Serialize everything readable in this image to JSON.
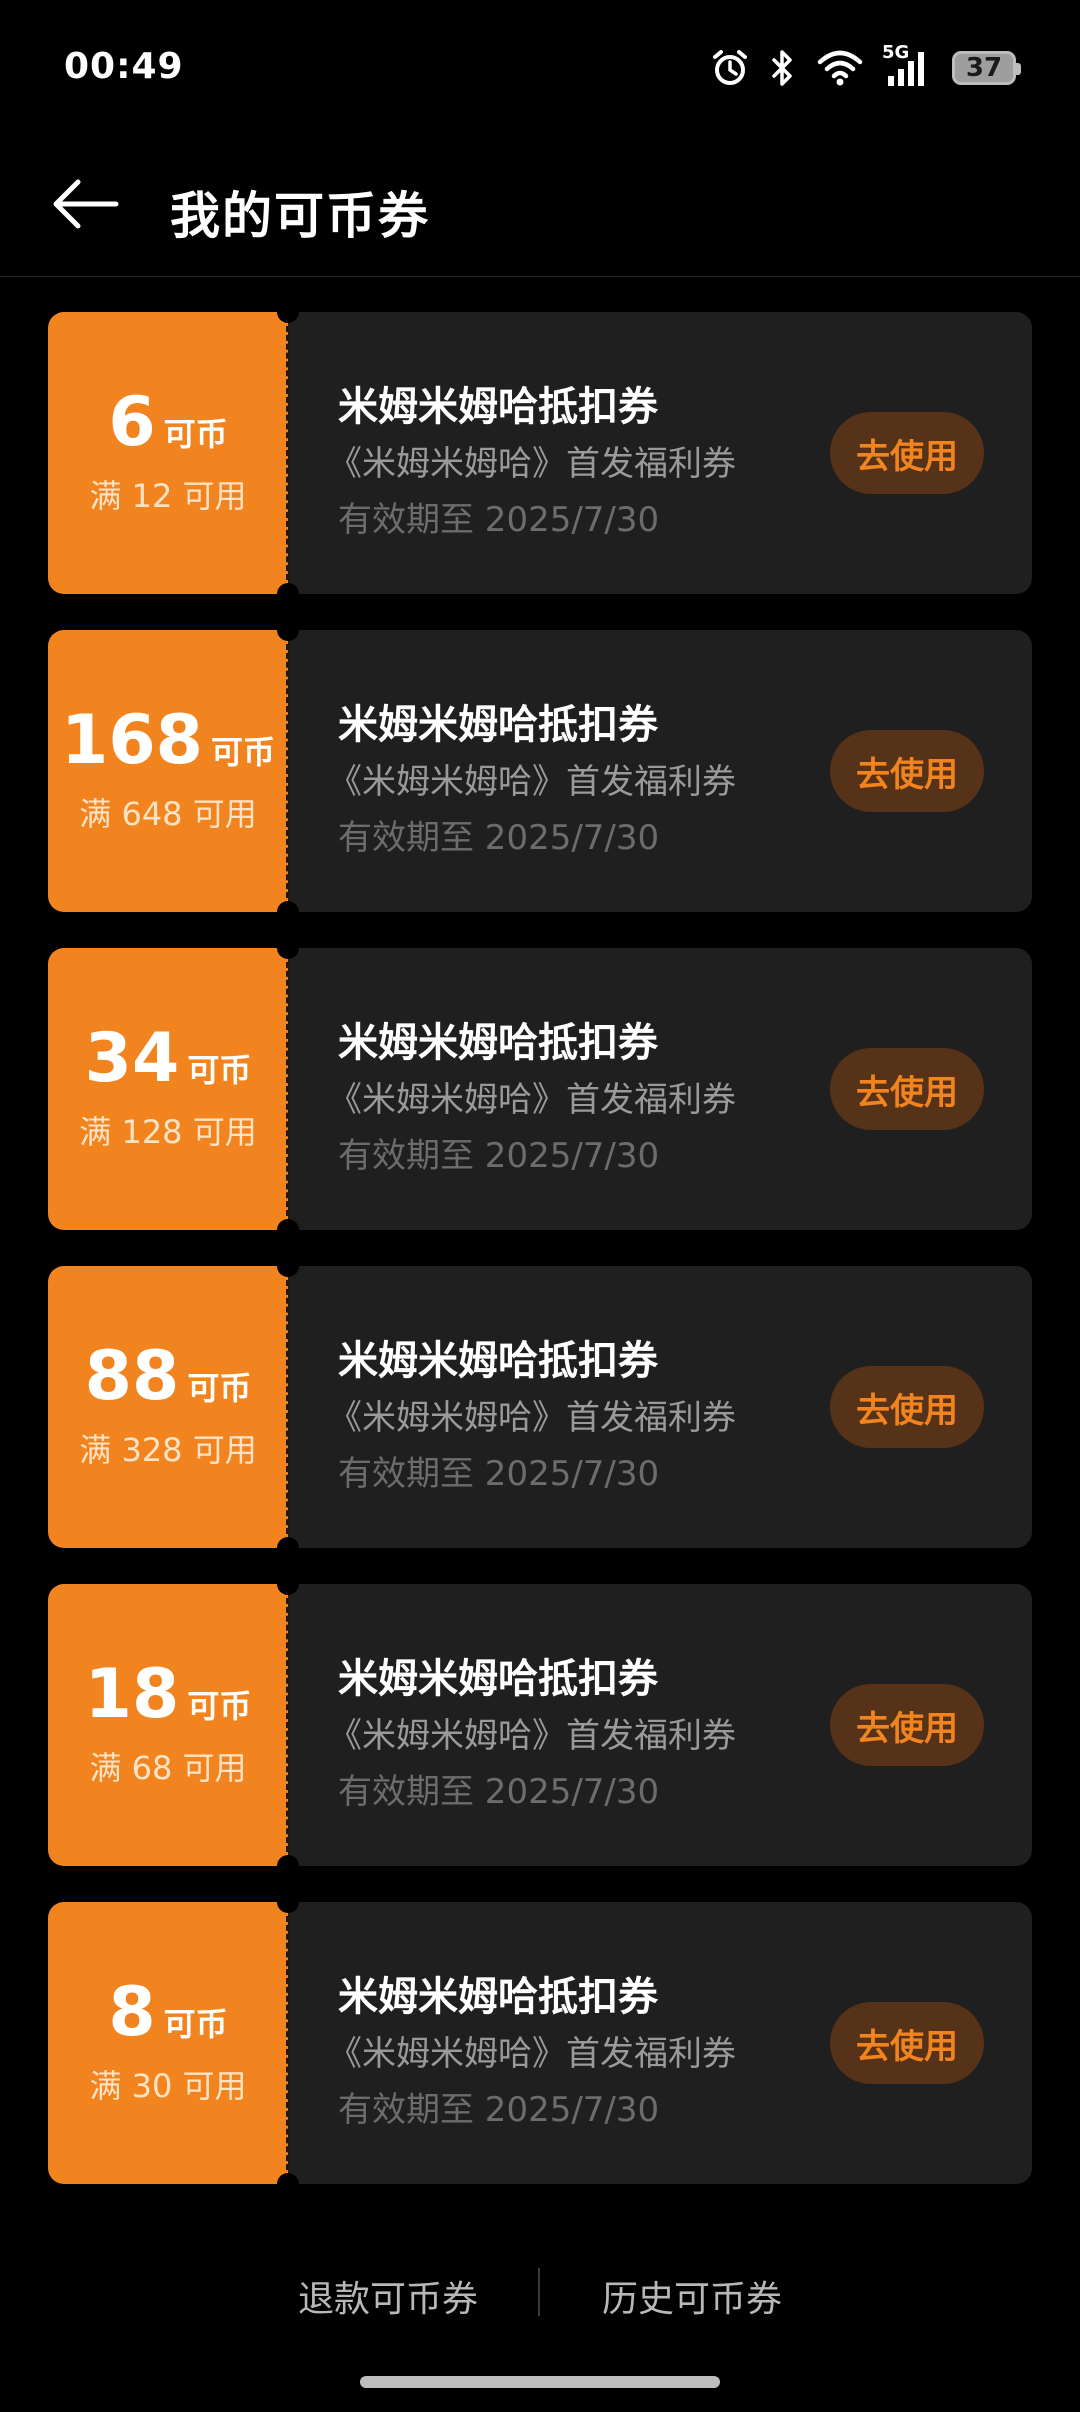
{
  "status_bar": {
    "time": "00:49",
    "network": "5G",
    "battery": "37",
    "icons": [
      "alarm-icon",
      "bluetooth-icon",
      "wifi-icon",
      "signal-icon",
      "battery-icon"
    ]
  },
  "header": {
    "back_icon": "arrow-left-icon",
    "title": "我的可币券"
  },
  "colors": {
    "accent": "#f2841f",
    "card_bg": "#1f1f1f",
    "button_bg": "#553218"
  },
  "coupons": [
    {
      "amount": "6",
      "unit": "可币",
      "condition": "满 12 可用",
      "name": "米姆米姆哈抵扣券",
      "desc": "《米姆米姆哈》首发福利券",
      "expiry": "有效期至 2025/7/30",
      "action": "去使用"
    },
    {
      "amount": "168",
      "unit": "可币",
      "condition": "满 648 可用",
      "name": "米姆米姆哈抵扣券",
      "desc": "《米姆米姆哈》首发福利券",
      "expiry": "有效期至 2025/7/30",
      "action": "去使用"
    },
    {
      "amount": "34",
      "unit": "可币",
      "condition": "满 128 可用",
      "name": "米姆米姆哈抵扣券",
      "desc": "《米姆米姆哈》首发福利券",
      "expiry": "有效期至 2025/7/30",
      "action": "去使用"
    },
    {
      "amount": "88",
      "unit": "可币",
      "condition": "满 328 可用",
      "name": "米姆米姆哈抵扣券",
      "desc": "《米姆米姆哈》首发福利券",
      "expiry": "有效期至 2025/7/30",
      "action": "去使用"
    },
    {
      "amount": "18",
      "unit": "可币",
      "condition": "满 68 可用",
      "name": "米姆米姆哈抵扣券",
      "desc": "《米姆米姆哈》首发福利券",
      "expiry": "有效期至 2025/7/30",
      "action": "去使用"
    },
    {
      "amount": "8",
      "unit": "可币",
      "condition": "满 30 可用",
      "name": "米姆米姆哈抵扣券",
      "desc": "《米姆米姆哈》首发福利券",
      "expiry": "有效期至 2025/7/30",
      "action": "去使用"
    }
  ],
  "footer": {
    "refund_label": "退款可币券",
    "history_label": "历史可币券"
  }
}
